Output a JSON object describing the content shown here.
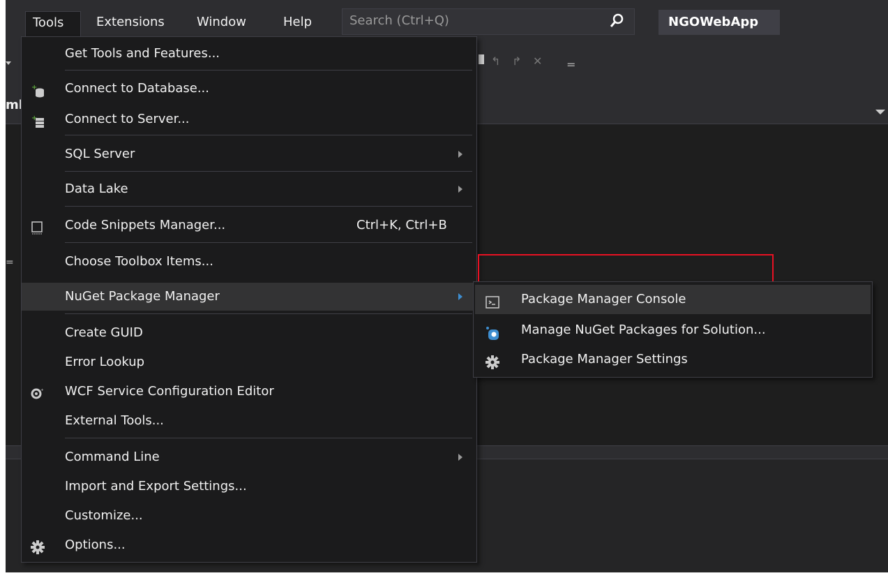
{
  "menubar": {
    "items": [
      "Tools",
      "Extensions",
      "Window",
      "Help"
    ],
    "search_placeholder": "Search (Ctrl+Q)",
    "solution_name": "NGOWebApp"
  },
  "tab_fragment": "ml",
  "editor_fragment": "=",
  "tools_menu": {
    "items": [
      {
        "label": "Get Tools and Features..."
      },
      {
        "label": "Connect to Database..."
      },
      {
        "label": "Connect to Server..."
      },
      {
        "label": "SQL Server"
      },
      {
        "label": "Data Lake"
      },
      {
        "label": "Code Snippets Manager...",
        "shortcut": "Ctrl+K, Ctrl+B"
      },
      {
        "label": "Choose Toolbox Items..."
      },
      {
        "label": "NuGet Package Manager"
      },
      {
        "label": "Create GUID"
      },
      {
        "label": "Error Lookup"
      },
      {
        "label": "WCF Service Configuration Editor"
      },
      {
        "label": "External Tools..."
      },
      {
        "label": "Command Line"
      },
      {
        "label": "Import and Export Settings..."
      },
      {
        "label": "Customize..."
      },
      {
        "label": "Options..."
      }
    ]
  },
  "nuget_submenu": {
    "items": [
      {
        "label": "Package Manager Console"
      },
      {
        "label": "Manage NuGet Packages for Solution..."
      },
      {
        "label": "Package Manager Settings"
      }
    ]
  },
  "colors": {
    "menu_bg": "#1b1b1c",
    "menubar_bg": "#2d2d30",
    "text": "#f1f1f1",
    "hover": "#333334",
    "accent_blue": "#3e8ed0",
    "highlight_red": "#e81123"
  },
  "icons": {
    "search": "search-icon",
    "database": "connect-database-icon",
    "server": "connect-server-icon",
    "snippets": "code-snippets-icon",
    "wcf": "wcf-config-icon",
    "options": "gear-icon",
    "console": "console-icon",
    "nuget": "nuget-icon",
    "settings": "gear-icon"
  }
}
